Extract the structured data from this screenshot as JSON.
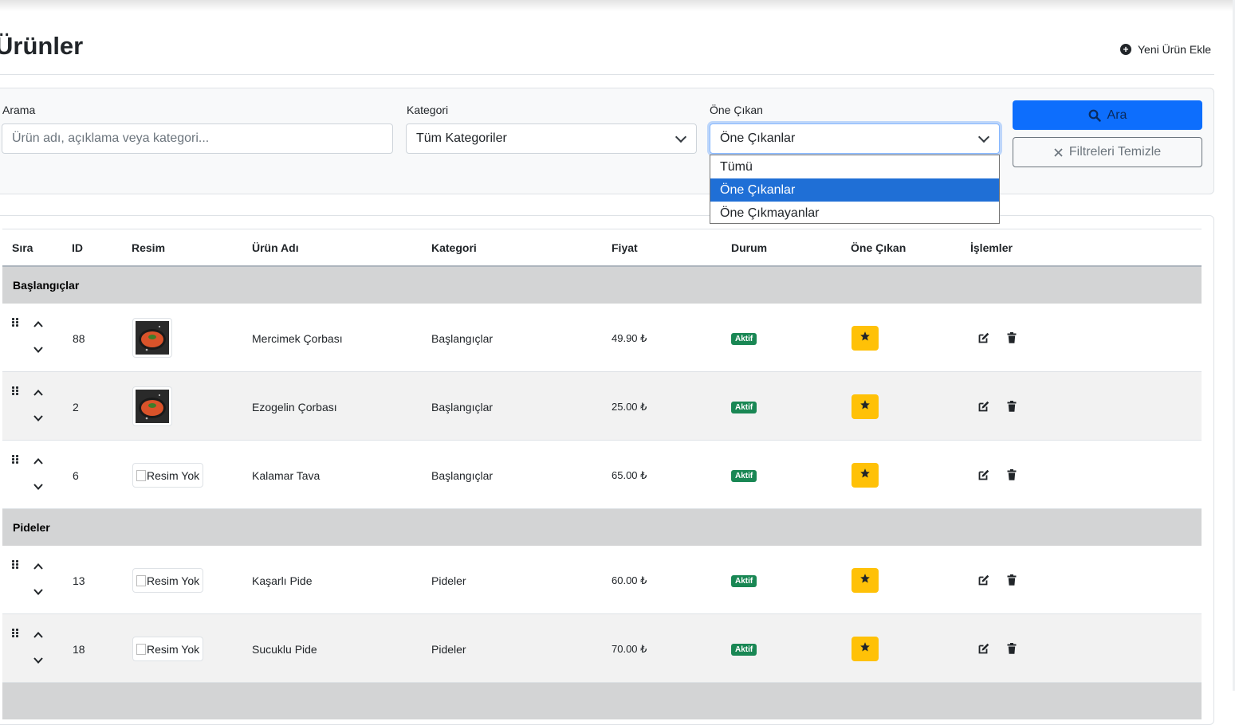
{
  "page": {
    "title": "Ürünler",
    "add_button": "Yeni Ürün Ekle"
  },
  "filters": {
    "search_label": "Arama",
    "search_placeholder": "Ürün adı, açıklama veya kategori...",
    "category_label": "Kategori",
    "category_value": "Tüm Kategoriler",
    "featured_label": "Öne Çıkan",
    "featured_value": "Öne Çıkanlar",
    "featured_options": [
      "Tümü",
      "Öne Çıkanlar",
      "Öne Çıkmayanlar"
    ],
    "search_button": "Ara",
    "clear_button": "Filtreleri Temizle"
  },
  "table": {
    "headers": [
      "Sıra",
      "ID",
      "Resim",
      "Ürün Adı",
      "Kategori",
      "Fiyat",
      "Durum",
      "Öne Çıkan",
      "İşlemler"
    ],
    "no_image_text": "Resim Yok",
    "status_text": "Aktif",
    "groups": [
      {
        "name": "Başlangıçlar",
        "rows": [
          {
            "id": "88",
            "has_image": true,
            "name": "Mercimek Çorbası",
            "category": "Başlangıçlar",
            "price": "49.90 ₺"
          },
          {
            "id": "2",
            "has_image": true,
            "name": "Ezogelin Çorbası",
            "category": "Başlangıçlar",
            "price": "25.00 ₺"
          },
          {
            "id": "6",
            "has_image": false,
            "name": "Kalamar Tava",
            "category": "Başlangıçlar",
            "price": "65.00 ₺"
          }
        ]
      },
      {
        "name": "Pideler",
        "rows": [
          {
            "id": "13",
            "has_image": false,
            "name": "Kaşarlı Pide",
            "category": "Pideler",
            "price": "60.00 ₺"
          },
          {
            "id": "18",
            "has_image": false,
            "name": "Sucuklu Pide",
            "category": "Pideler",
            "price": "70.00 ₺"
          }
        ]
      }
    ]
  },
  "colors": {
    "primary": "#0d6efd",
    "success": "#198754",
    "warning": "#ffc107",
    "group_bg": "#d3d4d5"
  }
}
